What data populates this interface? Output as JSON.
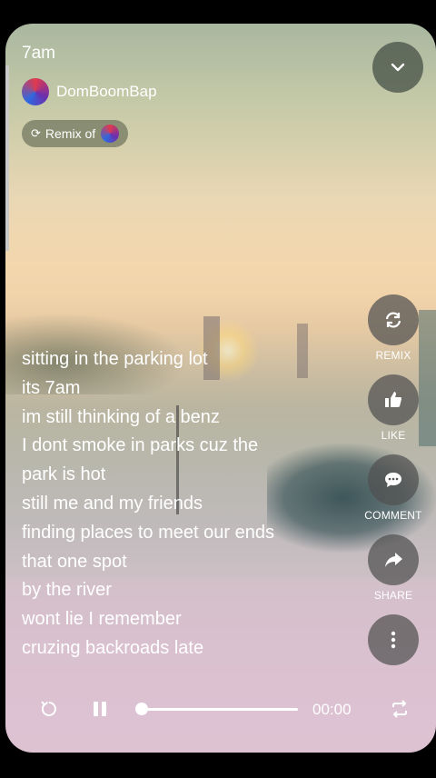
{
  "song": {
    "title": "7am",
    "artist": "DomBoomBap",
    "remix_label": "Remix of"
  },
  "icons": {
    "collapse": "chevron-down-icon",
    "remix": "remix-icon",
    "like": "thumbs-up-icon",
    "comment": "comment-icon",
    "share": "share-icon",
    "more": "more-vertical-icon",
    "restart": "restart-icon",
    "pause": "pause-icon",
    "repeat": "repeat-icon"
  },
  "actions": {
    "remix": "REMIX",
    "like": "LIKE",
    "comment": "COMMENT",
    "share": "SHARE"
  },
  "lyrics": [
    "sitting in the parking lot",
    "its 7am",
    "im still thinking of a benz",
    "I dont smoke in parks cuz the",
    "park is hot",
    "still me and my friends",
    "finding places to meet our ends",
    "that one spot",
    "by the river",
    "wont lie I remember",
    "cruzing backroads late"
  ],
  "player": {
    "time": "00:00",
    "progress": 0
  },
  "colors": {
    "button_bg": "#505050",
    "text": "#ffffff"
  }
}
